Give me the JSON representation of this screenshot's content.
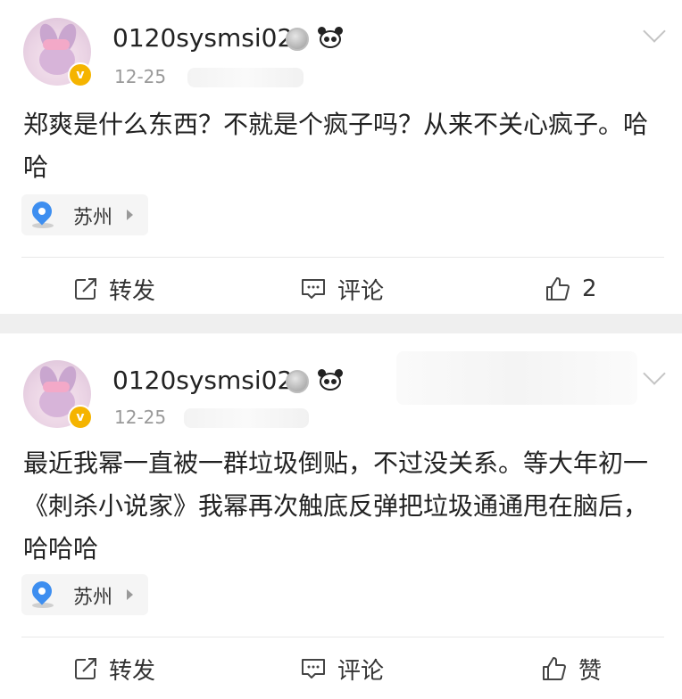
{
  "posts": [
    {
      "username": "0120sysmsi02",
      "time": "12-25",
      "content": "郑爽是什么东西？不就是个疯子吗？从来不关心疯子。哈哈",
      "location": "苏州",
      "actions": {
        "repost": "转发",
        "comment": "评论",
        "like": "2"
      }
    },
    {
      "username": "0120sysmsi02",
      "time": "12-25",
      "content": "最近我幂一直被一群垃圾倒贴，不过没关系。等大年初一《刺杀小说家》我幂再次触底反弹把垃圾通通甩在脑后，哈哈哈",
      "location": "苏州",
      "actions": {
        "repost": "转发",
        "comment": "评论",
        "like": "赞"
      }
    }
  ],
  "badges": {
    "verified": "v",
    "colors": {
      "verified": "#f5b400",
      "location_pin": "#3d8ef0"
    }
  },
  "icons": [
    "medal-icon",
    "panda-icon",
    "chevron-down-icon",
    "location-pin-icon",
    "repost-icon",
    "comment-icon",
    "like-icon"
  ]
}
